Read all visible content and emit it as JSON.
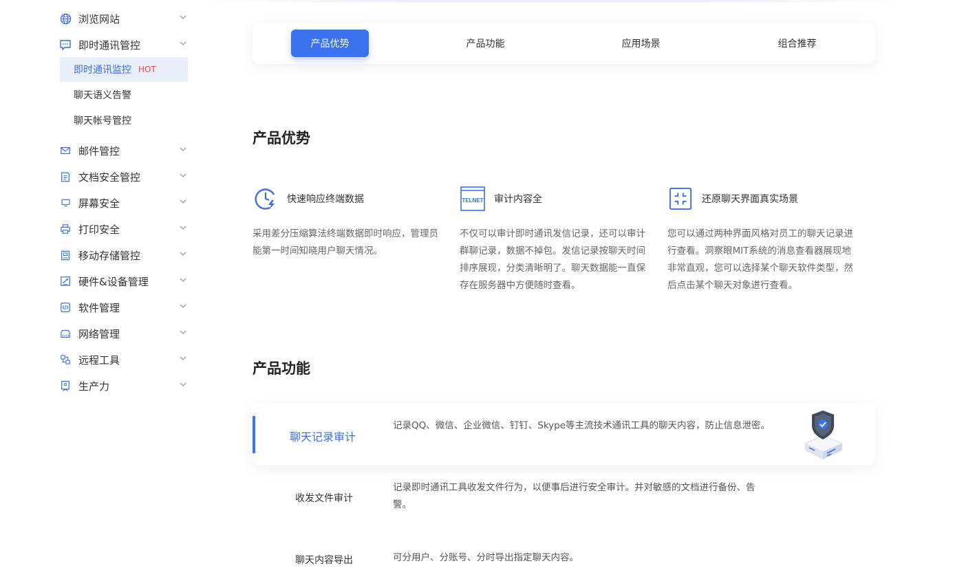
{
  "sidebar": {
    "items": [
      {
        "label": "浏览网站",
        "icon": "globe-icon"
      },
      {
        "label": "即时通讯管控",
        "icon": "chat-icon"
      },
      {
        "label": "邮件管控",
        "icon": "mail-icon"
      },
      {
        "label": "文档安全管控",
        "icon": "document-icon"
      },
      {
        "label": "屏幕安全",
        "icon": "monitor-icon"
      },
      {
        "label": "打印安全",
        "icon": "printer-icon"
      },
      {
        "label": "移动存储管控",
        "icon": "storage-icon"
      },
      {
        "label": "硬件&设备管理",
        "icon": "hardware-icon"
      },
      {
        "label": "软件管理",
        "icon": "code-icon"
      },
      {
        "label": "网络管理",
        "icon": "network-icon"
      },
      {
        "label": "远程工具",
        "icon": "remote-icon"
      },
      {
        "label": "生产力",
        "icon": "badge-icon"
      }
    ],
    "subitems": [
      {
        "label": "即时通讯监控",
        "badge": "HOT"
      },
      {
        "label": "聊天语义告警"
      },
      {
        "label": "聊天帐号管控"
      }
    ]
  },
  "tabs": [
    "产品优势",
    "产品功能",
    "应用场景",
    "组合推荐"
  ],
  "advantages": {
    "title": "产品优势",
    "items": [
      {
        "title": "快速响应终端数据",
        "desc": "采用差分压缩算法终端数据即时响应，管理员能第一时间知晓用户聊天情况。",
        "icon": "fast-clock-icon"
      },
      {
        "title": "审计内容全",
        "desc": "不仅可以审计即时通讯发信记录，还可以审计群聊记录，数据不掉包。发信记录按聊天时间排序展现，分类清晰明了。聊天数据能一直保存在服务器中方便随时查看。",
        "icon": "telnet-icon",
        "icon_text": "TELNET"
      },
      {
        "title": "还原聊天界面真实场景",
        "desc": "您可以通过两种界面风格对员工的聊天记录进行查看。洞察眼MIT系统的消息查看器展现地非常直观，您可以选择某个聊天软件类型，然后点击某个聊天对象进行查看。",
        "icon": "screen-frame-icon"
      }
    ]
  },
  "features": {
    "title": "产品功能",
    "items": [
      {
        "name": "聊天记录审计",
        "desc": "记录QQ、微信、企业微信、钉钉、Skype等主流技术通讯工具的聊天内容，防止信息泄密。"
      },
      {
        "name": "收发文件审计",
        "desc": "记录即时通讯工具收发文件行为，以便事后进行安全审计。并对敏感的文档进行备份、告警。"
      },
      {
        "name": "聊天内容导出",
        "desc": "可分用户、分账号、分时导出指定聊天内容。"
      }
    ]
  },
  "colors": {
    "accent": "#3b72f0",
    "hot": "#f2453d",
    "active_bg": "#e9eefb"
  }
}
